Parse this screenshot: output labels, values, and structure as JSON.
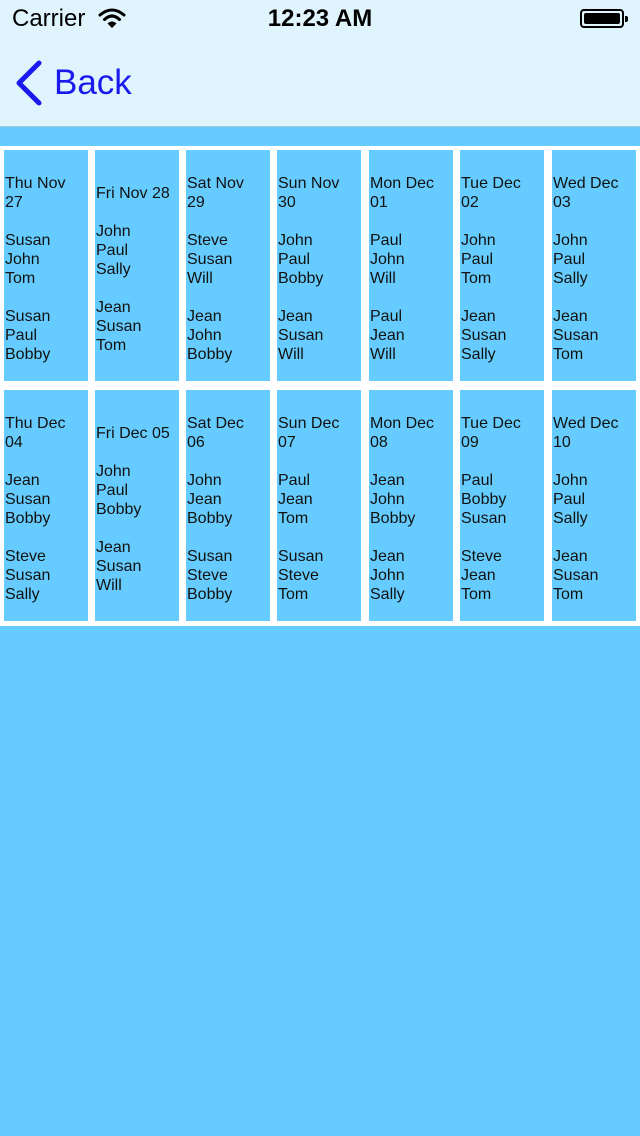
{
  "status_bar": {
    "carrier": "Carrier",
    "time": "12:23 AM"
  },
  "nav": {
    "back_label": "Back"
  },
  "rows": [
    {
      "cells": [
        {
          "date": [
            "Thu Nov",
            "27"
          ],
          "group1": [
            "Susan",
            "John",
            "Tom"
          ],
          "group2": [
            "Susan",
            "Paul",
            "Bobby"
          ]
        },
        {
          "date": [
            "Fri Nov 28"
          ],
          "group1": [
            "John",
            "Paul",
            "Sally"
          ],
          "group2": [
            "Jean",
            "Susan",
            "Tom"
          ]
        },
        {
          "date": [
            "Sat Nov",
            "29"
          ],
          "group1": [
            "Steve",
            "Susan",
            "Will"
          ],
          "group2": [
            "Jean",
            "John",
            "Bobby"
          ]
        },
        {
          "date": [
            "Sun Nov",
            "30"
          ],
          "group1": [
            "John",
            "Paul",
            "Bobby"
          ],
          "group2": [
            "Jean",
            "Susan",
            "Will"
          ]
        },
        {
          "date": [
            "Mon Dec",
            "01"
          ],
          "group1": [
            "Paul",
            "John",
            "Will"
          ],
          "group2": [
            "Paul",
            "Jean",
            "Will"
          ]
        },
        {
          "date": [
            "Tue Dec",
            "02"
          ],
          "group1": [
            "John",
            "Paul",
            "Tom"
          ],
          "group2": [
            "Jean",
            "Susan",
            "Sally"
          ]
        },
        {
          "date": [
            "Wed Dec",
            "03"
          ],
          "group1": [
            "John",
            "Paul",
            "Sally"
          ],
          "group2": [
            "Jean",
            "Susan",
            "Tom"
          ]
        }
      ]
    },
    {
      "cells": [
        {
          "date": [
            "Thu Dec",
            "04"
          ],
          "group1": [
            "Jean",
            "Susan",
            "Bobby"
          ],
          "group2": [
            "Steve",
            "Susan",
            "Sally"
          ]
        },
        {
          "date": [
            "Fri Dec 05"
          ],
          "group1": [
            "John",
            "Paul",
            "Bobby"
          ],
          "group2": [
            "Jean",
            "Susan",
            "Will"
          ]
        },
        {
          "date": [
            "Sat Dec",
            "06"
          ],
          "group1": [
            "John",
            "Jean",
            "Bobby"
          ],
          "group2": [
            "Susan",
            "Steve",
            "Bobby"
          ]
        },
        {
          "date": [
            "Sun Dec",
            "07"
          ],
          "group1": [
            "Paul",
            "Jean",
            "Tom"
          ],
          "group2": [
            "Susan",
            "Steve",
            "Tom"
          ]
        },
        {
          "date": [
            "Mon Dec",
            "08"
          ],
          "group1": [
            "Jean",
            "John",
            "Bobby"
          ],
          "group2": [
            "Jean",
            "John",
            "Sally"
          ]
        },
        {
          "date": [
            "Tue Dec",
            "09"
          ],
          "group1": [
            "Paul",
            "Bobby",
            "Susan"
          ],
          "group2": [
            "Steve",
            "Jean",
            "Tom"
          ]
        },
        {
          "date": [
            "Wed Dec",
            "10"
          ],
          "group1": [
            "John",
            "Paul",
            "Sally"
          ],
          "group2": [
            "Jean",
            "Susan",
            "Tom"
          ]
        }
      ]
    }
  ],
  "colors": {
    "background": "#66ccff",
    "nav_bar": "#e0f4fd",
    "back_tint": "#1a1aee",
    "grid_lines": "#ffffff"
  }
}
